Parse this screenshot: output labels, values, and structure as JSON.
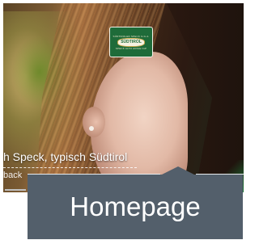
{
  "hero": {
    "caption": "h Speck, typisch Südtirol",
    "caption_secondary": "back",
    "logo": {
      "top_text": "SÜDTIROLER SPECK G.G.A.",
      "seal_text": "SÜDTIROL",
      "bottom_text": "SPECK ALTO ADIGE IGP"
    }
  },
  "tooltip": {
    "label": "Homepage"
  },
  "colors": {
    "tooltip_bg": "#535f6b",
    "logo_green": "#1e6b39"
  }
}
